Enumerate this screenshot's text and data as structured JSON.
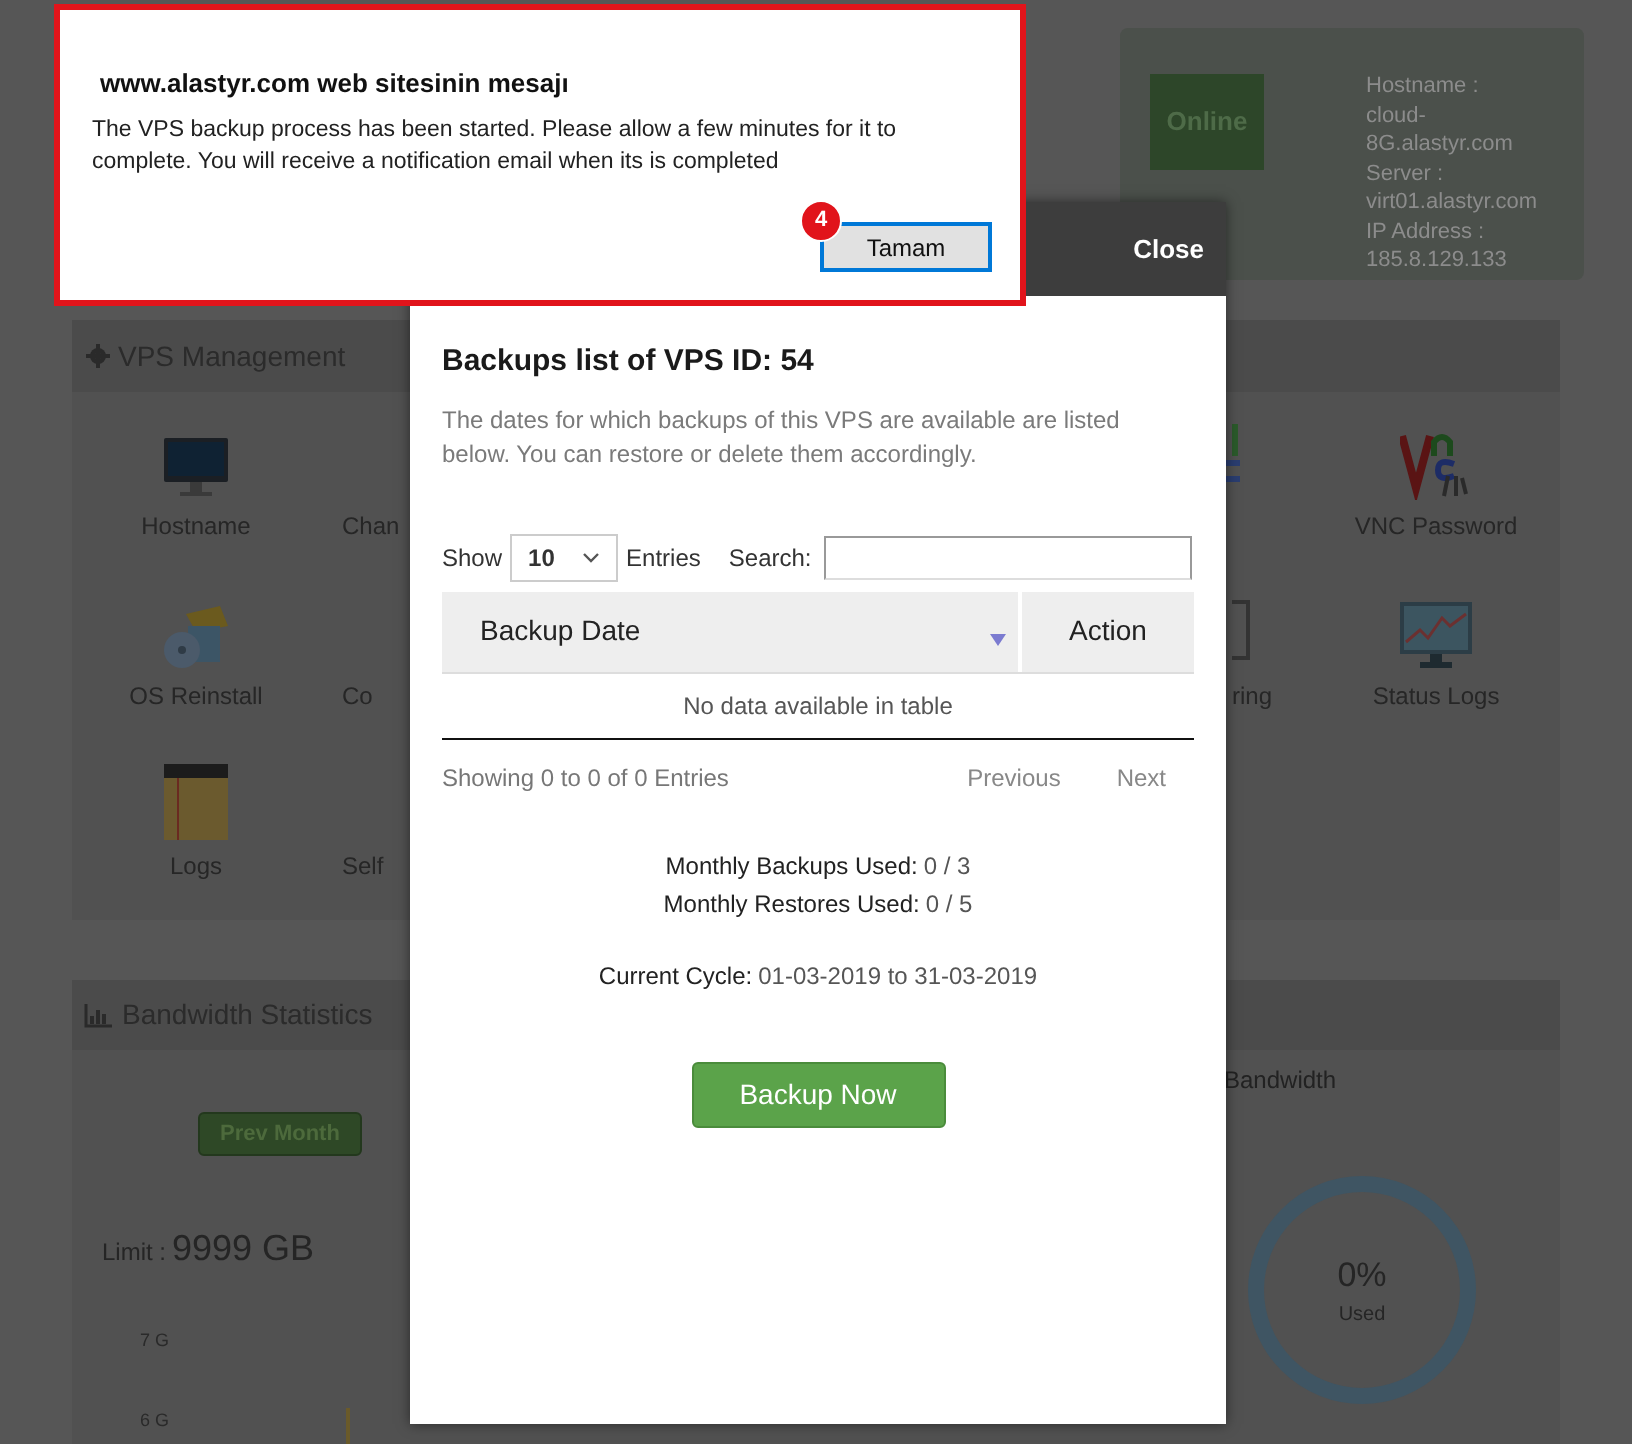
{
  "alert": {
    "title": "www.alastyr.com web sitesinin mesajı",
    "message": "The VPS backup process has been started. Please allow a few minutes for it to complete. You will receive a notification email when its is completed",
    "button": "Tamam",
    "badge": "4"
  },
  "server_card": {
    "status": "Online",
    "details": [
      "Hostname :",
      "cloud-",
      "8G.alastyr.com",
      "Server :",
      "virt01.alastyr.com",
      "IP Address :",
      "185.8.129.133"
    ]
  },
  "vps_management": {
    "title": "VPS Management",
    "columns": [
      {
        "kind": "full",
        "items": [
          {
            "label": "Hostname"
          },
          {
            "label": "OS Reinstall"
          },
          {
            "label": "Logs"
          }
        ]
      },
      {
        "kind": "cut",
        "items": [
          {
            "label": "Chan"
          },
          {
            "label": "Co"
          },
          {
            "label": "Self"
          }
        ]
      },
      {
        "kind": "edge",
        "items": [
          {
            "label": "ring"
          }
        ]
      },
      {
        "kind": "full",
        "items": [
          {
            "label": "VNC Password"
          },
          {
            "label": "Status Logs"
          }
        ]
      }
    ]
  },
  "bandwidth": {
    "title": "Bandwidth Statistics",
    "prev_button": "Prev Month",
    "limit_label": "Limit :",
    "limit_value": "9999 GB",
    "ticks": [
      "7 G",
      "6 G"
    ],
    "usage_title": "Bandwidth",
    "usage_percent": "0%",
    "usage_label": "Used"
  },
  "modal": {
    "close": "Close",
    "title": "Backups list of VPS ID: 54",
    "description": "The dates for which backups of this VPS are available are listed below. You can restore or delete them accordingly.",
    "show_label": "Show",
    "page_size": "10",
    "entries_label": "Entries",
    "search_label": "Search:",
    "columns": [
      {
        "label": "Backup Date",
        "sorted": true
      },
      {
        "label": "Action",
        "sorted": false
      }
    ],
    "empty_message": "No data available in table",
    "info": "Showing 0 to 0 of 0 Entries",
    "pagination": [
      {
        "label": "Previous",
        "disabled": true
      },
      {
        "label": "Next",
        "disabled": true
      }
    ],
    "stats": [
      {
        "label": "Monthly Backups Used:",
        "value": "0 / 3"
      },
      {
        "label": "Monthly Restores Used:",
        "value": "0 / 5"
      }
    ],
    "cycle": {
      "label": "Current Cycle:",
      "value": "01-03-2019 to 31-03-2019"
    },
    "backup_button": "Backup Now"
  }
}
